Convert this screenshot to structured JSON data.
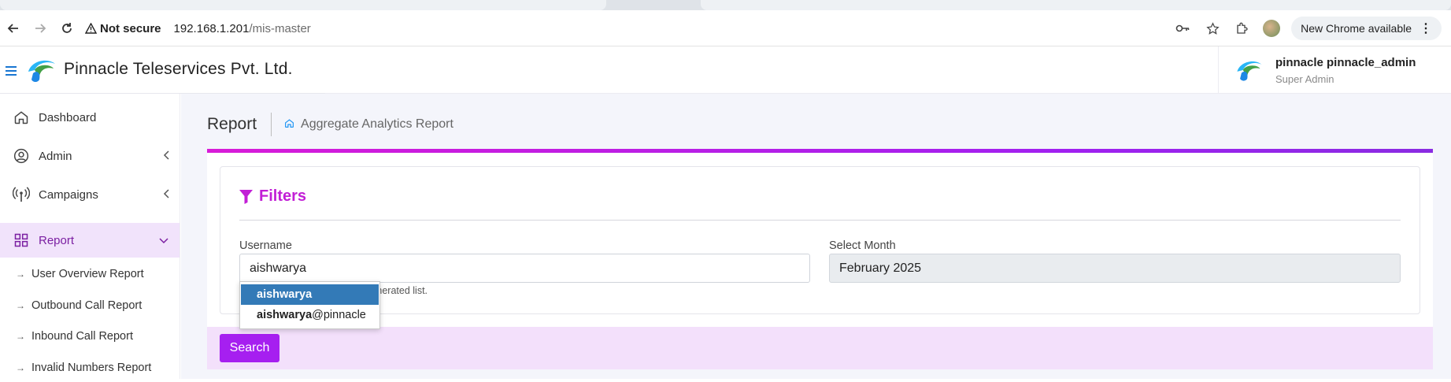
{
  "browser": {
    "security_label": "Not secure",
    "url_host": "192.168.1.201",
    "url_path": "/mis-master",
    "update_label": "New Chrome available"
  },
  "header": {
    "brand": "Pinnacle Teleservices Pvt. Ltd.",
    "user_name": "pinnacle pinnacle_admin",
    "user_role": "Super Admin"
  },
  "sidebar": {
    "items": [
      {
        "label": "Dashboard",
        "icon": "home-icon"
      },
      {
        "label": "Admin",
        "icon": "user-circle-icon",
        "chevron": "chevron-left-icon"
      },
      {
        "label": "Campaigns",
        "icon": "broadcast-icon",
        "chevron": "chevron-left-icon"
      },
      {
        "label": "Report",
        "icon": "grid-icon",
        "chevron": "chevron-down-icon",
        "active": true
      }
    ],
    "subitems": [
      {
        "label": "User Overview Report"
      },
      {
        "label": "Outbound Call Report"
      },
      {
        "label": "Inbound Call Report"
      },
      {
        "label": "Invalid Numbers Report"
      }
    ]
  },
  "page": {
    "title": "Report",
    "breadcrumb": "Aggregate Analytics Report"
  },
  "filters": {
    "title": "Filters",
    "username_label": "Username",
    "username_value": "aishwarya",
    "help_text": "a user from auto generated list.",
    "month_label": "Select Month",
    "month_value": "February 2025",
    "search_label": "Search"
  },
  "autocomplete": {
    "items": [
      {
        "match": "aishwarya",
        "rest": "",
        "selected": true
      },
      {
        "match": "aishwarya",
        "rest": "@pinnacle",
        "selected": false
      }
    ]
  },
  "colors": {
    "accent_purple": "#a61ff0",
    "filter_title": "#c21fd6",
    "sidebar_active_bg": "#f1e3fb",
    "dropdown_selected": "#337ab7",
    "link_blue": "#1976d2"
  }
}
